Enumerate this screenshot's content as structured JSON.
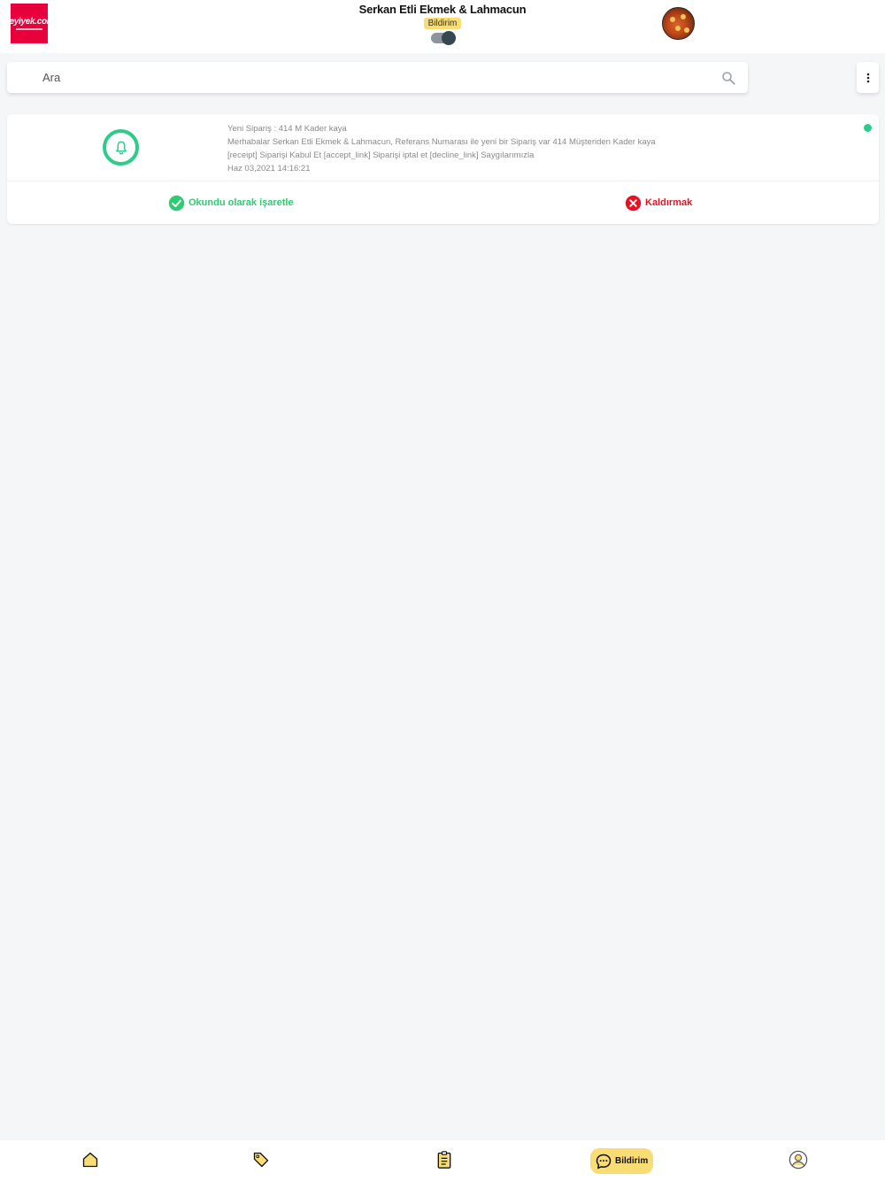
{
  "header": {
    "logo_text": "neyiyek.com",
    "store_name": "Serkan Etli Ekmek & Lahmacun",
    "badge_label": "Bildirim",
    "toggle_on": true
  },
  "search": {
    "placeholder": "Ara",
    "value": ""
  },
  "notification": {
    "title": "Yeni Sipariş : 414 M Kader kaya",
    "line1": "Merhabalar Serkan Etli Ekmek & Lahmacun, Referans Numarası ile yeni bir Sipariş var 414 Müşteriden Kader kaya",
    "line2": "[receipt] Siparişi Kabul Et [accept_link] Siparişi iptal et [decline_link] Saygılarımızla",
    "timestamp": "Haz 03,2021 14:16:21",
    "status_color": "#2ecc8b"
  },
  "actions": {
    "mark_read_label": "Okundu olarak işaretle",
    "remove_label": "Kaldırmak"
  },
  "bottom_nav": {
    "active_label": "Bildirim",
    "items": [
      "home-icon",
      "tag-icon",
      "clipboard-icon",
      "chat-icon",
      "profile-icon"
    ]
  },
  "colors": {
    "accent": "#f8dc74",
    "success": "#2ecc71",
    "danger": "#e81123",
    "brand": "#e8003d"
  }
}
